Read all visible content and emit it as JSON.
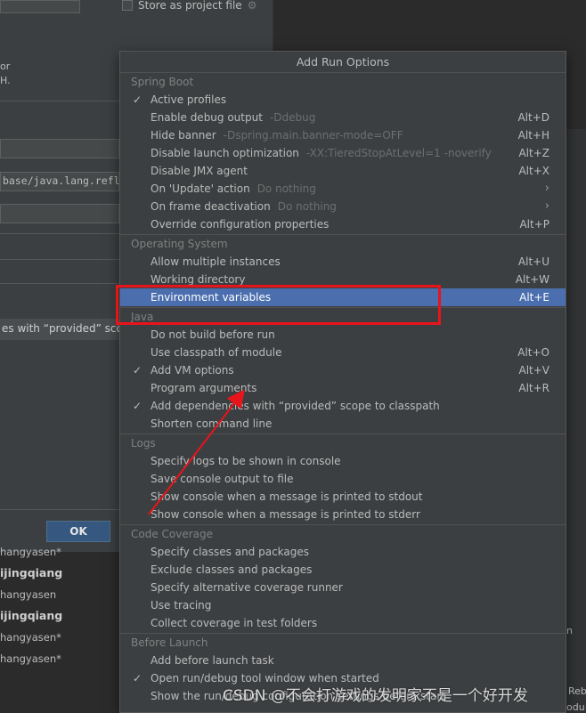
{
  "background": {
    "store_as_project_file": "Store as project file",
    "truncated_line1": "or",
    "truncated_line2": "H.",
    "field_value": "base/java.lang.refl",
    "provided_scope_text": "es with “provided” scop",
    "ok_label": "OK",
    "vcs_authors": [
      {
        "text": "hangyasen*",
        "bold": false
      },
      {
        "text": "ijingqiang",
        "bold": true
      },
      {
        "text": "hangyasen",
        "bold": false
      },
      {
        "text": "ijingqiang",
        "bold": true
      },
      {
        "text": "hangyasen*",
        "bold": false
      },
      {
        "text": "hangyasen*",
        "bold": false
      }
    ],
    "edge_right_1": "n",
    "edge_right_2": "Reb",
    "edge_right_3": "odu"
  },
  "popup": {
    "title": "Add Run Options",
    "groups": [
      {
        "label": "Spring Boot",
        "items": [
          {
            "label": "Active profiles",
            "hint": "",
            "shortcut": "",
            "checked": true,
            "submenu": false,
            "selected": false
          },
          {
            "label": "Enable debug output",
            "hint": "-Ddebug",
            "shortcut": "Alt+D",
            "checked": false,
            "submenu": false,
            "selected": false
          },
          {
            "label": "Hide banner",
            "hint": "-Dspring.main.banner-mode=OFF",
            "shortcut": "Alt+H",
            "checked": false,
            "submenu": false,
            "selected": false
          },
          {
            "label": "Disable launch optimization",
            "hint": "-XX:TieredStopAtLevel=1 -noverify",
            "shortcut": "Alt+Z",
            "checked": false,
            "submenu": false,
            "selected": false
          },
          {
            "label": "Disable JMX agent",
            "hint": "",
            "shortcut": "Alt+X",
            "checked": false,
            "submenu": false,
            "selected": false
          },
          {
            "label": "On 'Update' action",
            "hint": "Do nothing",
            "shortcut": "",
            "checked": false,
            "submenu": true,
            "selected": false
          },
          {
            "label": "On frame deactivation",
            "hint": "Do nothing",
            "shortcut": "",
            "checked": false,
            "submenu": true,
            "selected": false
          },
          {
            "label": "Override configuration properties",
            "hint": "",
            "shortcut": "Alt+P",
            "checked": false,
            "submenu": false,
            "selected": false
          }
        ]
      },
      {
        "label": "Operating System",
        "items": [
          {
            "label": "Allow multiple instances",
            "hint": "",
            "shortcut": "Alt+U",
            "checked": false,
            "submenu": false,
            "selected": false
          },
          {
            "label": "Working directory",
            "hint": "",
            "shortcut": "Alt+W",
            "checked": false,
            "submenu": false,
            "selected": false
          },
          {
            "label": "Environment variables",
            "hint": "",
            "shortcut": "Alt+E",
            "checked": false,
            "submenu": false,
            "selected": true
          }
        ]
      },
      {
        "label": "Java",
        "items": [
          {
            "label": "Do not build before run",
            "hint": "",
            "shortcut": "",
            "checked": false,
            "submenu": false,
            "selected": false
          },
          {
            "label": "Use classpath of module",
            "hint": "",
            "shortcut": "Alt+O",
            "checked": false,
            "submenu": false,
            "selected": false
          },
          {
            "label": "Add VM options",
            "hint": "",
            "shortcut": "Alt+V",
            "checked": true,
            "submenu": false,
            "selected": false
          },
          {
            "label": "Program arguments",
            "hint": "",
            "shortcut": "Alt+R",
            "checked": false,
            "submenu": false,
            "selected": false
          },
          {
            "label": "Add dependencies with “provided” scope to classpath",
            "hint": "",
            "shortcut": "",
            "checked": true,
            "submenu": false,
            "selected": false
          },
          {
            "label": "Shorten command line",
            "hint": "",
            "shortcut": "",
            "checked": false,
            "submenu": false,
            "selected": false
          }
        ]
      },
      {
        "label": "Logs",
        "items": [
          {
            "label": "Specify logs to be shown in console",
            "hint": "",
            "shortcut": "",
            "checked": false,
            "submenu": false,
            "selected": false
          },
          {
            "label": "Save console output to file",
            "hint": "",
            "shortcut": "",
            "checked": false,
            "submenu": false,
            "selected": false
          },
          {
            "label": "Show console when a message is printed to stdout",
            "hint": "",
            "shortcut": "",
            "checked": false,
            "submenu": false,
            "selected": false
          },
          {
            "label": "Show console when a message is printed to stderr",
            "hint": "",
            "shortcut": "",
            "checked": false,
            "submenu": false,
            "selected": false
          }
        ]
      },
      {
        "label": "Code Coverage",
        "items": [
          {
            "label": "Specify classes and packages",
            "hint": "",
            "shortcut": "",
            "checked": false,
            "submenu": false,
            "selected": false
          },
          {
            "label": "Exclude classes and packages",
            "hint": "",
            "shortcut": "",
            "checked": false,
            "submenu": false,
            "selected": false
          },
          {
            "label": "Specify alternative coverage runner",
            "hint": "",
            "shortcut": "",
            "checked": false,
            "submenu": false,
            "selected": false
          },
          {
            "label": "Use tracing",
            "hint": "",
            "shortcut": "",
            "checked": false,
            "submenu": false,
            "selected": false
          },
          {
            "label": "Collect coverage in test folders",
            "hint": "",
            "shortcut": "",
            "checked": false,
            "submenu": false,
            "selected": false
          }
        ]
      },
      {
        "label": "Before Launch",
        "items": [
          {
            "label": "Add before launch task",
            "hint": "",
            "shortcut": "",
            "checked": false,
            "submenu": false,
            "selected": false
          },
          {
            "label": "Open run/debug tool window when started",
            "hint": "",
            "shortcut": "",
            "checked": true,
            "submenu": false,
            "selected": false
          },
          {
            "label": "Show the run/debug configuration settings before start",
            "hint": "",
            "shortcut": "",
            "checked": false,
            "submenu": false,
            "selected": false
          }
        ]
      }
    ]
  },
  "annotation": {
    "highlight_color": "#e8141b",
    "watermark": "CSDN @不会打游戏的发明家不是一个好开发"
  },
  "colors": {
    "popup_bg": "#3c3f41",
    "selection": "#4b6eaf",
    "hint_text": "#6e6e6e",
    "group_label": "#808080"
  }
}
